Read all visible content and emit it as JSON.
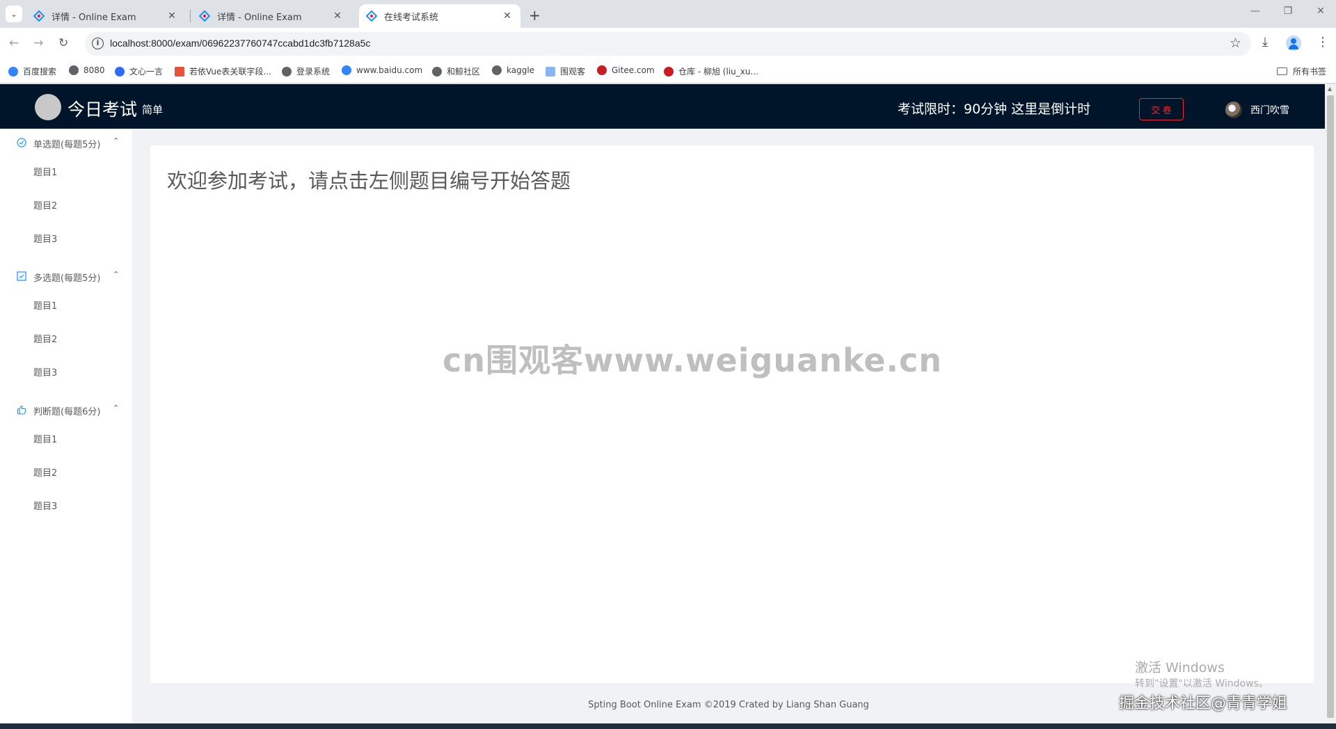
{
  "browser": {
    "tabs": [
      {
        "title": "详情 - Online Exam"
      },
      {
        "title": "详情 - Online Exam"
      },
      {
        "title": "在线考试系统"
      }
    ],
    "url": "localhost:8000/exam/06962237760747ccabd1dc3fb7128a5c",
    "bookmarks": [
      {
        "label": "百度搜索",
        "color": "#3385ff"
      },
      {
        "label": "8080",
        "color": "#5f6368"
      },
      {
        "label": "文心一言",
        "color": "#2f6bff"
      },
      {
        "label": "若依Vue表关联字段...",
        "color": "#e5533d"
      },
      {
        "label": "登录系统",
        "color": "#5f6368"
      },
      {
        "label": "www.baidu.com",
        "color": "#3385ff"
      },
      {
        "label": "和鲸社区",
        "color": "#5f6368"
      },
      {
        "label": "kaggle",
        "color": "#5f6368"
      },
      {
        "label": "围观客",
        "color": "#8ab4f8"
      },
      {
        "label": "Gitee.com",
        "color": "#c71d23"
      },
      {
        "label": "仓库 - 柳旭 (liu_xu...",
        "color": "#c71d23"
      }
    ],
    "all_bookmarks": "所有书签"
  },
  "header": {
    "title": "今日考试",
    "subtitle": "简单",
    "timer": "考试限时：90分钟 这里是倒计时",
    "submit_label": "交 卷",
    "user_name": "西门吹雪"
  },
  "sidebar": {
    "groups": [
      {
        "title": "单选题(每题5分)",
        "items": [
          "题目1",
          "题目2",
          "题目3"
        ]
      },
      {
        "title": "多选题(每题5分)",
        "items": [
          "题目1",
          "题目2",
          "题目3"
        ]
      },
      {
        "title": "判断题(每题6分)",
        "items": [
          "题目1",
          "题目2",
          "题目3"
        ]
      }
    ]
  },
  "main": {
    "welcome": "欢迎参加考试，请点击左侧题目编号开始答题",
    "watermark": "cn围观客www.weiguanke.cn"
  },
  "footer": "Spting Boot Online Exam ©2019 Crated by Liang Shan Guang",
  "overlay": {
    "activate_title": "激活 Windows",
    "activate_sub": "转到\"设置\"以激活 Windows。",
    "community": "掘金技术社区@青青学姐"
  },
  "colors": {
    "header_bg": "#001529",
    "danger": "#f5222d",
    "page_bg": "#f0f2f5"
  }
}
